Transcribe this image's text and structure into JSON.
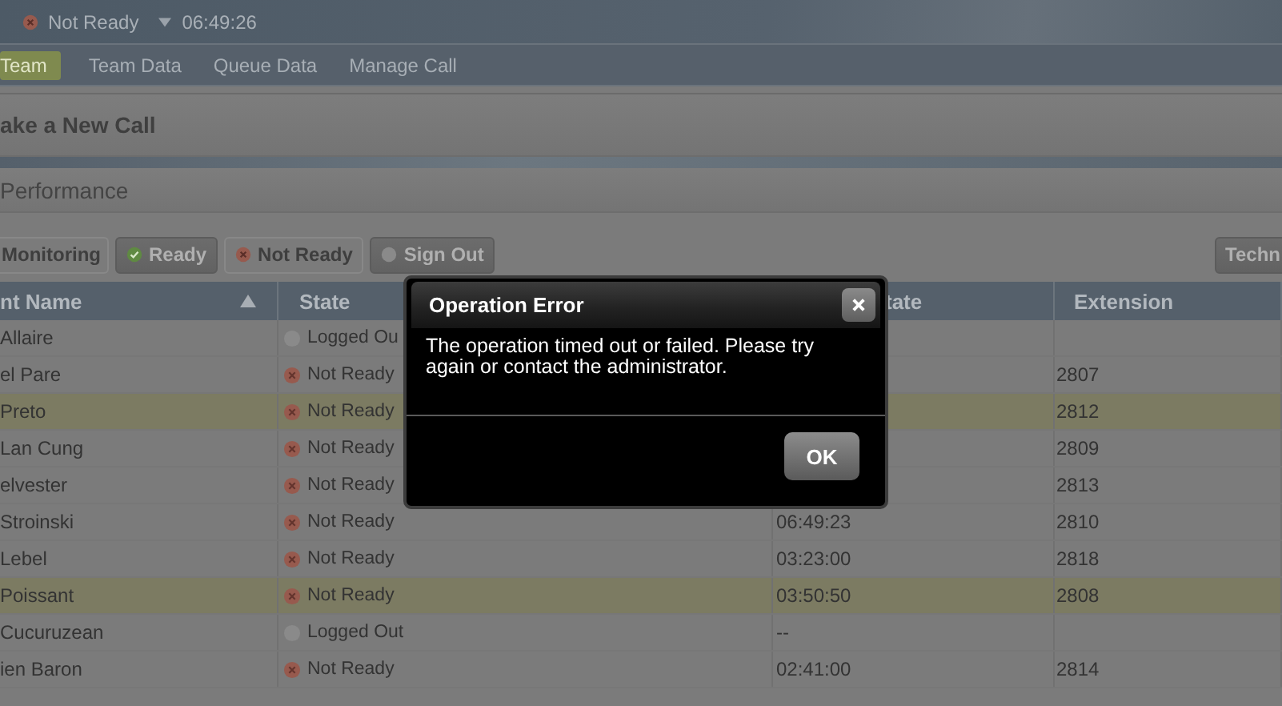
{
  "status_bar": {
    "state": "Not Ready",
    "kind": "not_ready",
    "time": "06:49:26"
  },
  "tabs": [
    {
      "label": "Team",
      "selected": true
    },
    {
      "label": "Team Data",
      "selected": false
    },
    {
      "label": "Queue Data",
      "selected": false
    },
    {
      "label": "Manage Call",
      "selected": false
    }
  ],
  "new_call_panel": {
    "title": "ake a New Call"
  },
  "performance_panel": {
    "title": "Performance"
  },
  "toolbar": [
    {
      "label": "Monitoring",
      "disabled": true
    },
    {
      "label": "Ready",
      "kind": "ready",
      "disabled": false
    },
    {
      "label": "Not Ready",
      "kind": "not_ready",
      "disabled": true
    },
    {
      "label": "Sign Out",
      "kind": "logged_out",
      "disabled": false
    }
  ],
  "toolbar_right_button": {
    "label": "Techn"
  },
  "table": {
    "columns": [
      {
        "label": "nt Name",
        "sorted": true
      },
      {
        "label": "State"
      },
      {
        "label": "tate"
      },
      {
        "label": "Extension"
      }
    ],
    "rows": [
      {
        "name": "Allaire",
        "state": "Logged Ou",
        "kind": "logged_out",
        "highlighted": false
      },
      {
        "name": "el Pare",
        "state": "Not Ready",
        "kind": "not_ready",
        "extension": "2807",
        "highlighted": false
      },
      {
        "name": "Preto",
        "state": "Not Ready",
        "kind": "not_ready",
        "extension": "2812",
        "highlighted": true
      },
      {
        "name": "Lan Cung",
        "state": "Not Ready",
        "kind": "not_ready",
        "extension": "2809",
        "highlighted": false
      },
      {
        "name": "elvester",
        "state": "Not Ready",
        "kind": "not_ready",
        "extension": "2813",
        "highlighted": false
      },
      {
        "name": "Stroinski",
        "state": "Not Ready",
        "kind": "not_ready",
        "time": "06:49:23",
        "extension": "2810",
        "highlighted": false
      },
      {
        "name": "Lebel",
        "state": "Not Ready",
        "kind": "not_ready",
        "time": "03:23:00",
        "extension": "2818",
        "highlighted": false
      },
      {
        "name": "Poissant",
        "state": "Not Ready",
        "kind": "not_ready",
        "time": "03:50:50",
        "extension": "2808",
        "highlighted": true
      },
      {
        "name": "Cucuruzean",
        "state": "Logged Out",
        "kind": "logged_out",
        "time": "--",
        "highlighted": false
      },
      {
        "name": "ien Baron",
        "state": "Not Ready",
        "kind": "not_ready",
        "time": "02:41:00",
        "extension": "2814",
        "highlighted": false
      }
    ]
  },
  "dialog": {
    "title": "Operation Error",
    "message": "The operation timed out or failed. Please try again or contact the administrator.",
    "button": "OK"
  }
}
